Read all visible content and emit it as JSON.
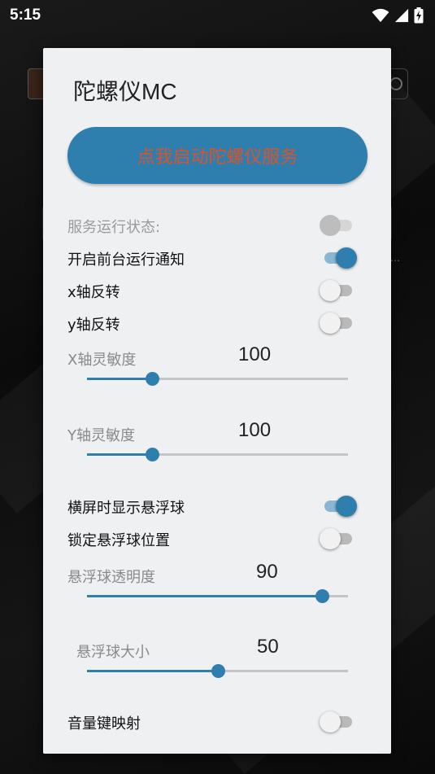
{
  "status_bar": {
    "time": "5:15"
  },
  "dialog": {
    "title": "陀螺仪MC",
    "start_button_label": "点我启动陀螺仪服务",
    "switches": [
      {
        "label": "服务运行状态:",
        "on": false,
        "disabled": true
      },
      {
        "label": "开启前台运行通知",
        "on": true,
        "disabled": false
      },
      {
        "label": "x轴反转",
        "on": false,
        "disabled": false
      },
      {
        "label": "y轴反转",
        "on": false,
        "disabled": false
      }
    ],
    "sliders_top": [
      {
        "label": "X轴灵敏度",
        "value": "100",
        "fraction": 0.25
      },
      {
        "label": "Y轴灵敏度",
        "value": "100",
        "fraction": 0.25
      }
    ],
    "switches_mid": [
      {
        "label": "横屏时显示悬浮球",
        "on": true,
        "disabled": false
      },
      {
        "label": "锁定悬浮球位置",
        "on": false,
        "disabled": false
      }
    ],
    "sliders_bottom": [
      {
        "label": "悬浮球透明度",
        "value": "90",
        "fraction": 0.9
      },
      {
        "label": "悬浮球大小",
        "value": "50",
        "fraction": 0.5
      }
    ],
    "switches_bottom": [
      {
        "label": "音量键映射",
        "on": false,
        "disabled": false
      }
    ]
  },
  "colors": {
    "accent": "#2f7fae",
    "button_text": "#d9532c",
    "dialog_bg": "#eff0f2"
  }
}
